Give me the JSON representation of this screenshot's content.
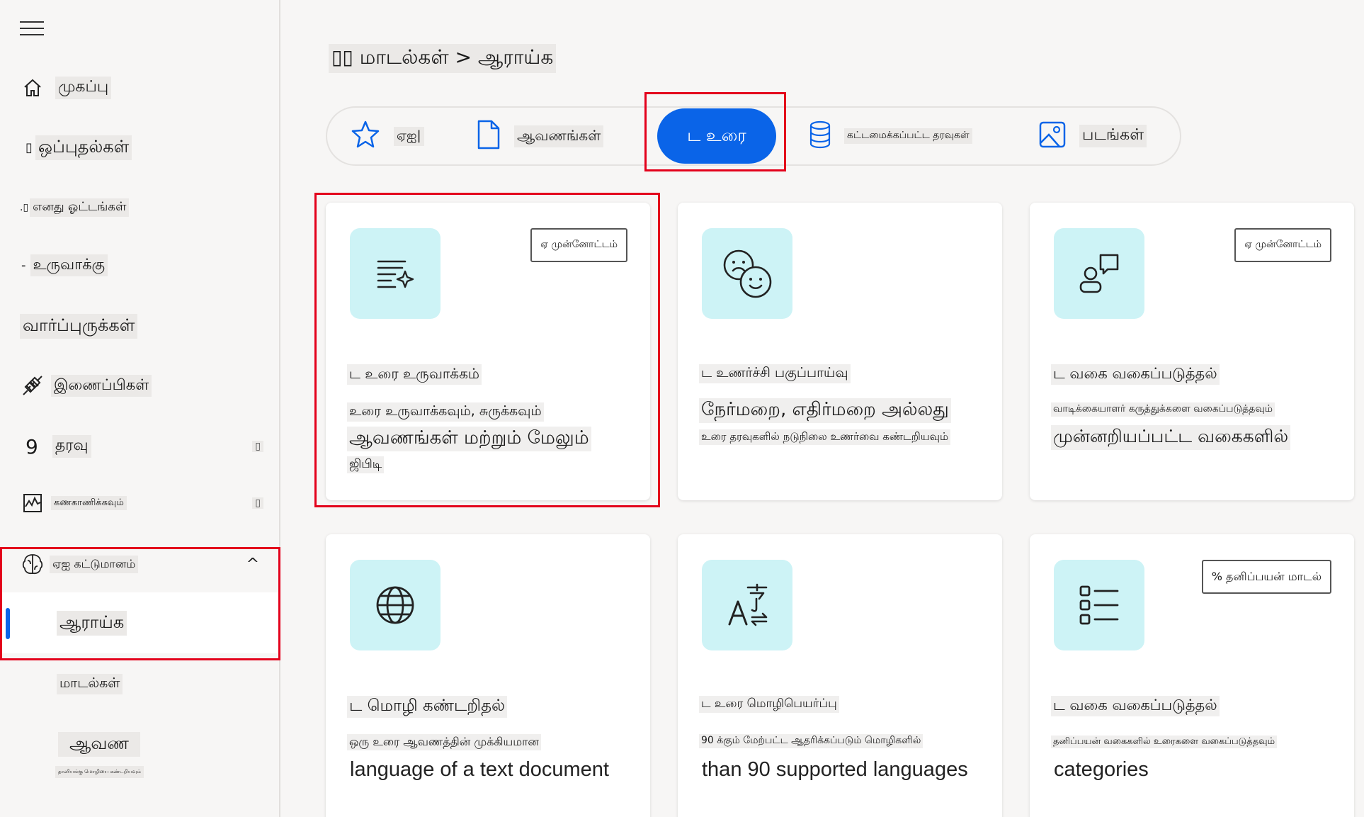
{
  "sidebar": {
    "items": [
      {
        "label": "முகப்பு",
        "icon": "home-icon"
      },
      {
        "label": "ஒப்புதல்கள்",
        "icon": "approvals-icon",
        "prefix": "▯"
      },
      {
        "label": "எனது ஓட்டங்கள்",
        "prefix": ".▯"
      },
      {
        "label": "உருவாக்கு",
        "prefix": "-"
      },
      {
        "label": "வார்ப்புருக்கள்"
      },
      {
        "label": "இணைப்பிகள்",
        "icon": "connectors-icon"
      },
      {
        "label": "தரவு",
        "icon": "data-icon",
        "glyph": "9",
        "trail": "▯"
      },
      {
        "label": "கணகாணிக்கவும்",
        "icon": "monitor-icon",
        "trail": "▯"
      },
      {
        "label": "ஏஐ கட்டுமானம்",
        "icon": "ai-brain-icon",
        "expander": "^"
      },
      {
        "label": "ஆராய்க"
      },
      {
        "label": "மாடல்கள்"
      },
      {
        "label": "ஆவண"
      },
      {
        "label": "தானியங்கு மொழியை கண்டறியவும்"
      }
    ]
  },
  "breadcrumb": "▯▯ மாடல்கள் > ஆராய்க",
  "tabs": [
    {
      "label": "ஏஐ|",
      "icon": "star-icon"
    },
    {
      "label": "ஆவணங்கள்",
      "icon": "document-icon"
    },
    {
      "label": "ட உரை",
      "active": true
    },
    {
      "label": "கட்டமைக்கப்பட்ட தரவுகள்",
      "icon": "database-icon"
    },
    {
      "label": "படங்கள்",
      "icon": "image-icon"
    }
  ],
  "cards": [
    {
      "category": "ட உரை உருவாக்கம்",
      "line1": "உரை உருவாக்கவும், சுருக்கவும்",
      "line2": "ஆவணங்கள் மற்றும் மேலும்",
      "line3": "ஜிபிடி",
      "badge": "ஏ முன்னோட்டம்",
      "icon": "text-sparkle-icon"
    },
    {
      "category": "ட உணர்ச்சி பகுப்பாய்வு",
      "line1": "நேர்மறை, எதிர்மறை அல்லது",
      "line2": "உரை தரவுகளில் நடுநிலை உணர்வை கண்டறியவும்",
      "icon": "emoji-icon"
    },
    {
      "category": "ட வகை வகைப்படுத்தல்",
      "line1": "வாடிக்கையாளர் கருத்துக்களை வகைப்படுத்தவும்",
      "line2": "முன்னறியப்பட்ட வகைகளில்",
      "badge": "ஏ முன்னோட்டம்",
      "icon": "person-feedback-icon"
    },
    {
      "category": "ட மொழி கண்டறிதல்",
      "line1": "ஒரு உரை ஆவணத்தின் முக்கியமான",
      "en": "language of a text document",
      "icon": "globe-icon"
    },
    {
      "category": "ட உரை மொழிபெயர்ப்பு",
      "line1": "90 க்கும் மேற்பட்ட ஆதரிக்கப்படும் மொழிகளில்",
      "en": "than 90 supported languages",
      "icon": "translate-icon"
    },
    {
      "category": "ட வகை வகைப்படுத்தல்",
      "line1": "தனிப்பயன் வகைகளில் உரைகளை வகைப்படுத்தவும்",
      "en": "categories",
      "badge": "% தனிப்பயன் மாடல்",
      "icon": "list-icon"
    }
  ],
  "colors": {
    "accent": "#0a64e8",
    "highlight": "#e3001b",
    "icon_bg": "#cdf3f6"
  }
}
